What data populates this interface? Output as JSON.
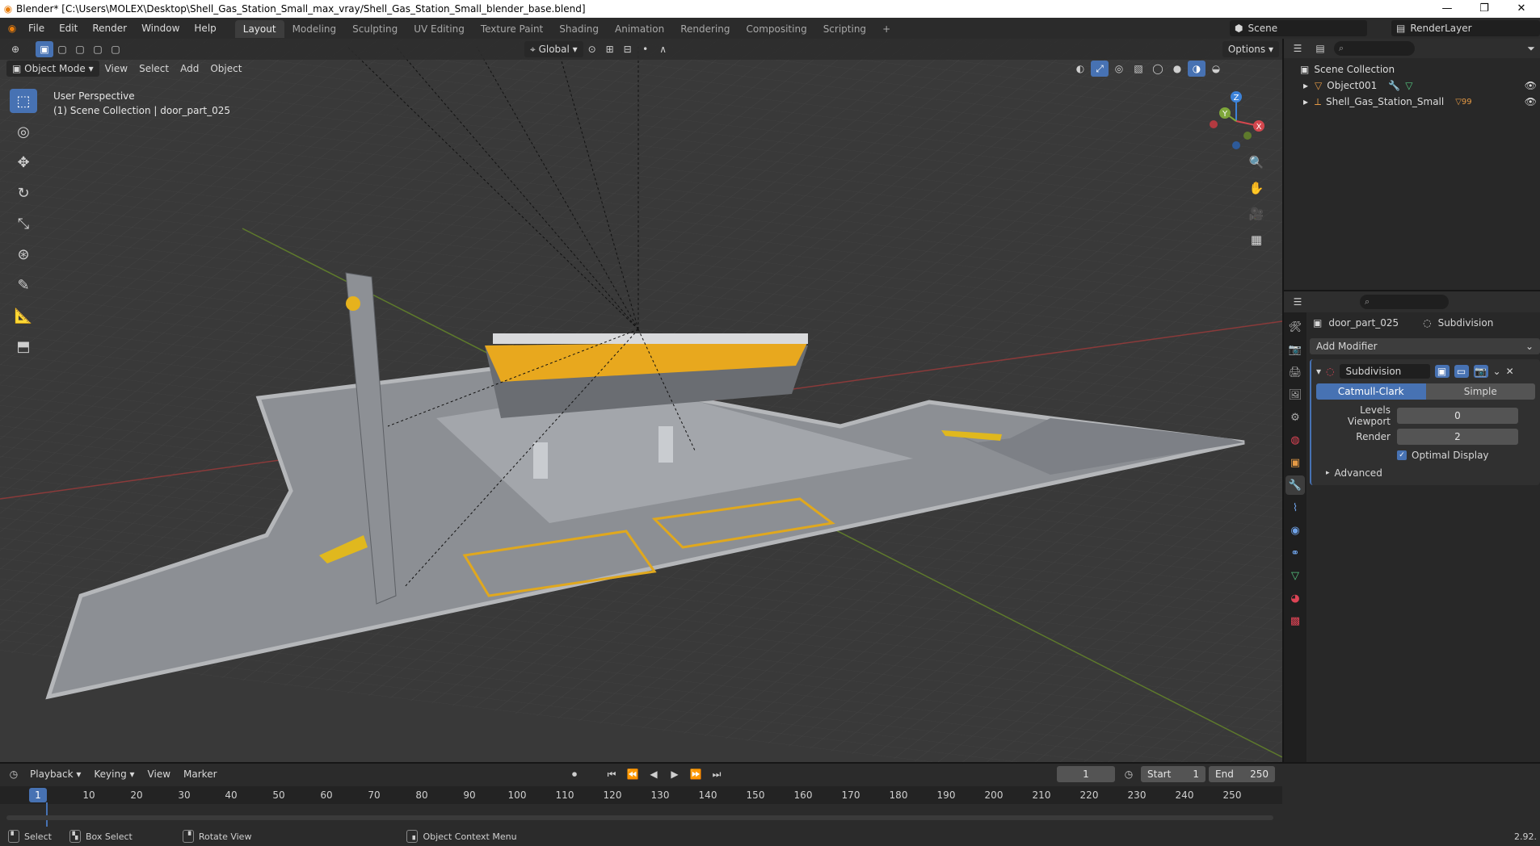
{
  "title_bar": {
    "title": "Blender* [C:\\Users\\MOLEX\\Desktop\\Shell_Gas_Station_Small_max_vray/Shell_Gas_Station_Small_blender_base.blend]",
    "min": "—",
    "max": "❐",
    "close": "✕"
  },
  "menu": [
    "File",
    "Edit",
    "Render",
    "Window",
    "Help"
  ],
  "workspaces": [
    "Layout",
    "Modeling",
    "Sculpting",
    "UV Editing",
    "Texture Paint",
    "Shading",
    "Animation",
    "Rendering",
    "Compositing",
    "Scripting"
  ],
  "scene": {
    "label": "Scene"
  },
  "render_layer": {
    "label": "RenderLayer"
  },
  "viewport": {
    "mode": "Object Mode",
    "menus": [
      "View",
      "Select",
      "Add",
      "Object"
    ],
    "transform": "Global",
    "options": "Options",
    "info_line1": "User Perspective",
    "info_line2": "(1) Scene Collection | door_part_025",
    "gizmo": {
      "x": "X",
      "y": "Y",
      "z": "Z"
    }
  },
  "outliner": {
    "root": "Scene Collection",
    "items": [
      "Object001",
      "Shell_Gas_Station_Small"
    ],
    "badge": "99"
  },
  "properties": {
    "object_name": "door_part_025",
    "modifier_tab": "Subdivision",
    "add_modifier": "Add Modifier",
    "modifier_name": "Subdivision",
    "mode_catmull": "Catmull-Clark",
    "mode_simple": "Simple",
    "levels_label": "Levels Viewport",
    "levels_value": "0",
    "render_label": "Render",
    "render_value": "2",
    "optimal_label": "Optimal Display",
    "advanced_label": "Advanced"
  },
  "timeline": {
    "menus": [
      "Playback",
      "Keying",
      "View",
      "Marker"
    ],
    "current_frame": "1",
    "start_label": "Start",
    "start_value": "1",
    "end_label": "End",
    "end_value": "250",
    "ticks": [
      "10",
      "20",
      "30",
      "40",
      "50",
      "60",
      "70",
      "80",
      "90",
      "100",
      "110",
      "120",
      "130",
      "140",
      "150",
      "160",
      "170",
      "180",
      "190",
      "200",
      "210",
      "220",
      "230",
      "240",
      "250"
    ]
  },
  "status_bar": {
    "select": "Select",
    "box_select": "Box Select",
    "rotate_view": "Rotate View",
    "context_menu": "Object Context Menu",
    "version": "2.92."
  },
  "colors": {
    "accent": "#4772b3",
    "viewport_bg": "#393939",
    "x_axis": "#d4474e",
    "y_axis": "#7ea63a",
    "z_axis": "#3c82d8"
  }
}
